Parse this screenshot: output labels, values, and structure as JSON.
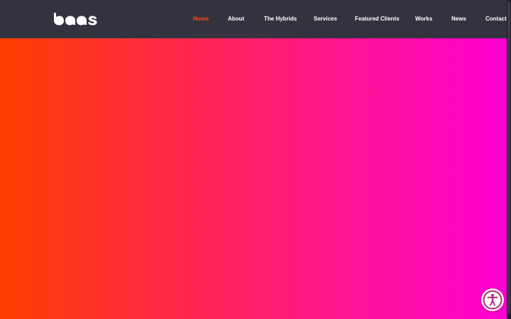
{
  "header": {
    "logo_icon": "bqqs-logo-icon"
  },
  "nav": {
    "items": [
      {
        "label": "Home",
        "active": true
      },
      {
        "label": "About",
        "active": false
      },
      {
        "label": "The Hybrids",
        "active": false
      },
      {
        "label": "Services",
        "active": false
      },
      {
        "label": "Featured Clients",
        "active": false
      },
      {
        "label": "Works",
        "active": false
      },
      {
        "label": "News",
        "active": false
      },
      {
        "label": "Contact",
        "active": false
      }
    ]
  },
  "hero": {
    "gradient_start": "#ff3d00",
    "gradient_end": "#ff00d4"
  },
  "colors": {
    "header_bg": "#333340",
    "active_nav": "#ff4d1a",
    "nav_text": "#ffffff",
    "accessibility_accent": "#b5247a"
  },
  "accessibility": {
    "icon": "accessibility-icon"
  }
}
